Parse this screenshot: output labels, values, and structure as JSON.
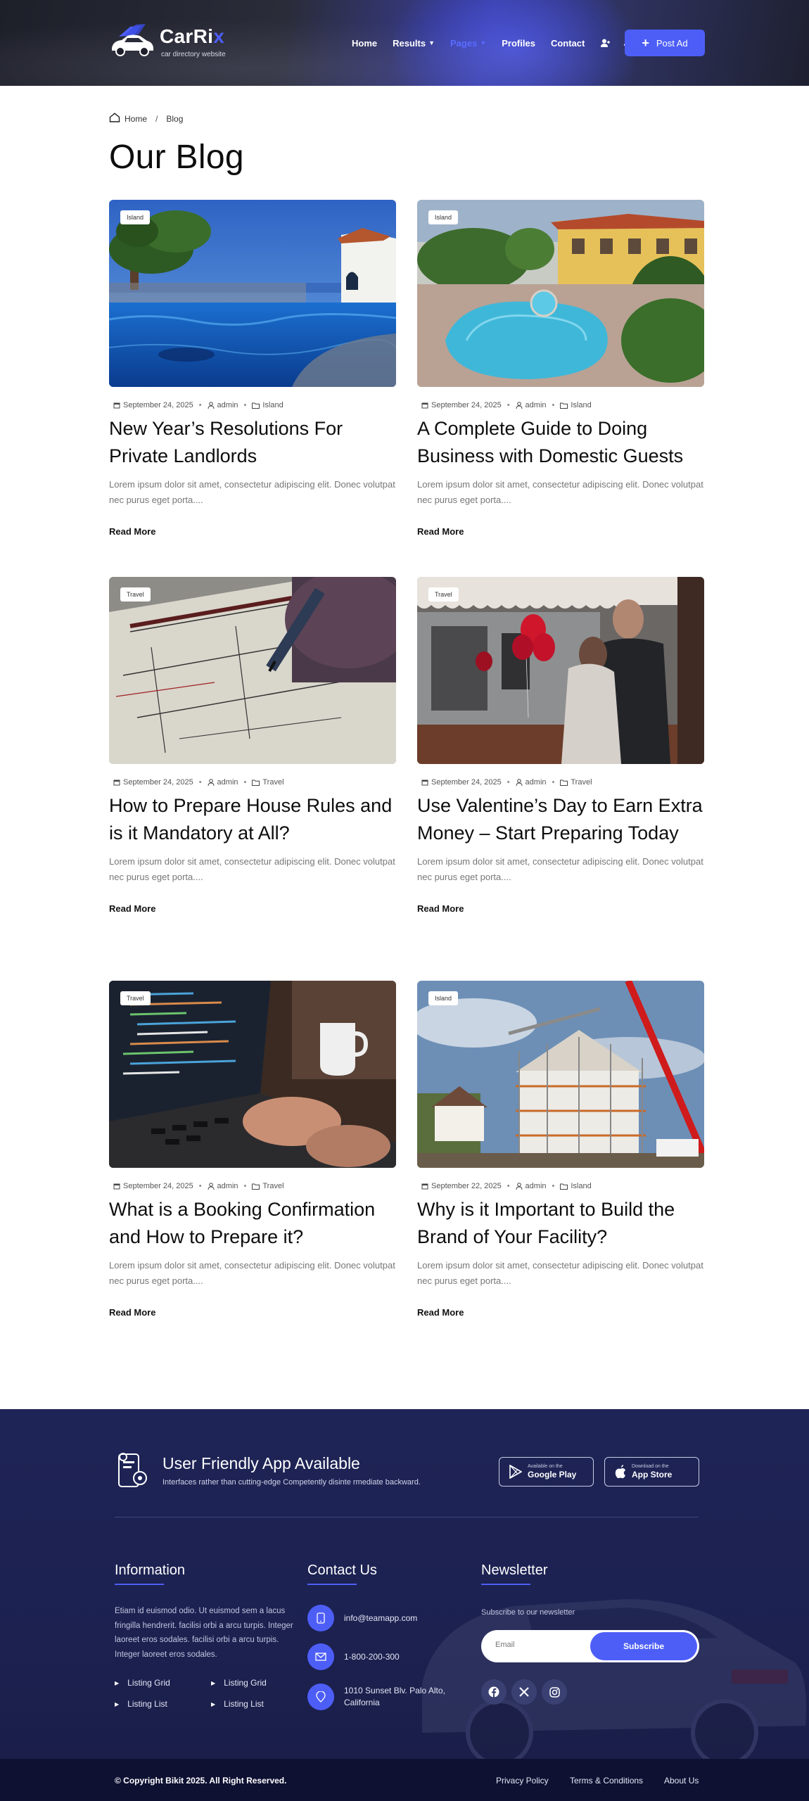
{
  "header": {
    "logo_name_main": "CarRi",
    "logo_name_accent": "x",
    "logo_tagline": "car directory website",
    "nav": [
      {
        "label": "Home",
        "dropdown": false,
        "active": false
      },
      {
        "label": "Results",
        "dropdown": true,
        "active": false
      },
      {
        "label": "Pages",
        "dropdown": true,
        "active": true
      },
      {
        "label": "Profiles",
        "dropdown": false,
        "active": false
      },
      {
        "label": "Contact",
        "dropdown": false,
        "active": false
      }
    ],
    "icons": [
      "user-plus-icon",
      "dashboard-icon"
    ],
    "post_button": "Post Ad",
    "accent_color": "#4d5ef7"
  },
  "breadcrumb": {
    "home": "Home",
    "separator": "/",
    "current": "Blog"
  },
  "page_title": "Our Blog",
  "posts": [
    {
      "tag": "Island",
      "date": "September 24, 2025",
      "author": "admin",
      "category": "Island",
      "title": "New Year’s Resolutions For Private Landlords",
      "excerpt": "Lorem ipsum dolor sit amet, consectetur adipiscing elit. Donec volutpat nec purus eget porta....",
      "read_more": "Read More",
      "image": "villa-pool-photo"
    },
    {
      "tag": "Island",
      "date": "September 24, 2025",
      "author": "admin",
      "category": "Island",
      "title": "A Complete Guide to Doing Business with Domestic Guests",
      "excerpt": "Lorem ipsum dolor sit amet, consectetur adipiscing elit. Donec volutpat nec purus eget porta....",
      "read_more": "Read More",
      "image": "resort-pool-photo"
    },
    {
      "tag": "Travel",
      "date": "September 24, 2025",
      "author": "admin",
      "category": "Travel",
      "title": "How to Prepare House Rules and is it Mandatory at All?",
      "excerpt": "Lorem ipsum dolor sit amet, consectetur adipiscing elit. Donec volutpat nec purus eget porta....",
      "read_more": "Read More",
      "image": "blueprint-drawing-photo"
    },
    {
      "tag": "Travel",
      "date": "September 24, 2025",
      "author": "admin",
      "category": "Travel",
      "title": "Use Valentine’s Day to Earn Extra Money – Start Preparing Today",
      "excerpt": "Lorem ipsum dolor sit amet, consectetur adipiscing elit. Donec volutpat nec purus eget porta....",
      "read_more": "Read More",
      "image": "couple-balloons-photo"
    },
    {
      "tag": "Travel",
      "date": "September 24, 2025",
      "author": "admin",
      "category": "Travel",
      "title": "What is a Booking Confirmation and How to Prepare it?",
      "excerpt": "Lorem ipsum dolor sit amet, consectetur adipiscing elit. Donec volutpat nec purus eget porta....",
      "read_more": "Read More",
      "image": "laptop-typing-photo"
    },
    {
      "tag": "Island",
      "date": "September 22, 2025",
      "author": "admin",
      "category": "Island",
      "title": "Why is it Important to Build the Brand of Your Facility?",
      "excerpt": "Lorem ipsum dolor sit amet, consectetur adipiscing elit. Donec volutpat nec purus eget porta....",
      "read_more": "Read More",
      "image": "house-construction-photo"
    }
  ],
  "footer": {
    "app_title": "User Friendly App Available",
    "app_subtitle": "Interfaces rather than cutting-edge Competently disinte rmediate backward.",
    "google_play_small": "Available on the",
    "google_play_big": "Google Play",
    "app_store_small": "Download on the",
    "app_store_big": "App Store",
    "information": {
      "title": "Information",
      "text": "Etiam id euismod odio. Ut euismod sem a lacus fringilla hendrerit. facilisi orbi a arcu turpis. Integer laoreet eros sodales. facilisi orbi a arcu turpis. Integer laoreet eros sodales.",
      "links": [
        "Listing Grid",
        "Listing Grid",
        "Listing List",
        "Listing List"
      ]
    },
    "contact": {
      "title": "Contact Us",
      "email": "info@teamapp.com",
      "phone": "1-800-200-300",
      "address": "1010 Sunset Blv. Palo Alto, California"
    },
    "newsletter": {
      "title": "Newsletter",
      "label": "Subscribe to our newsletter",
      "placeholder": "Email",
      "button": "Subscribe",
      "socials": [
        "facebook-icon",
        "x-twitter-icon",
        "instagram-icon"
      ]
    },
    "copyright": "© Copyright Bikit 2025. All Right Reserved.",
    "bottom_links": [
      "Privacy Policy",
      "Terms & Conditions",
      "About Us"
    ]
  }
}
